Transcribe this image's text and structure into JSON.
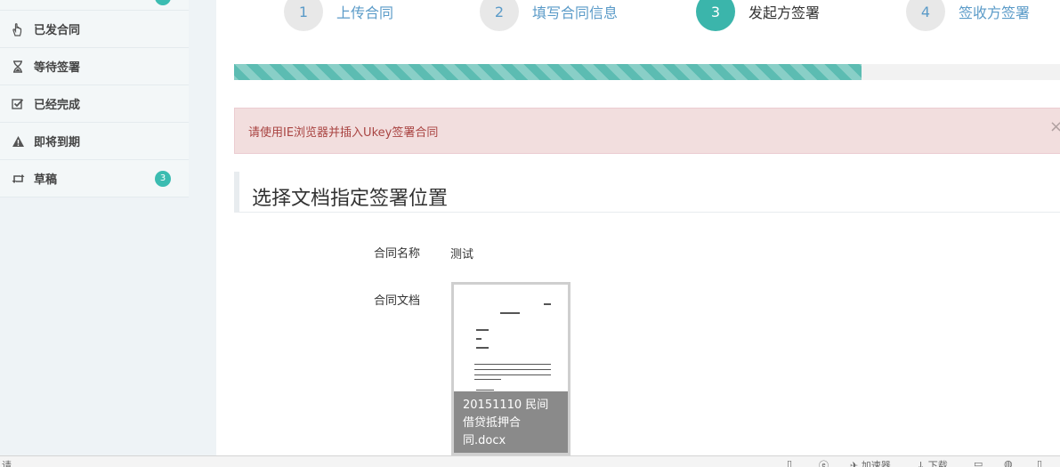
{
  "sidebar": {
    "items": [
      {
        "label": "已发合同",
        "icon": "hand-pointer-icon"
      },
      {
        "label": "等待签署",
        "icon": "hourglass-icon"
      },
      {
        "label": "已经完成",
        "icon": "check-square-icon"
      },
      {
        "label": "即将到期",
        "icon": "warning-icon"
      },
      {
        "label": "草稿",
        "icon": "retweet-icon",
        "badge": "3"
      }
    ]
  },
  "steps": [
    {
      "num": "1",
      "label": "上传合同"
    },
    {
      "num": "2",
      "label": "填写合同信息"
    },
    {
      "num": "3",
      "label": "发起方签署"
    },
    {
      "num": "4",
      "label": "签收方签署"
    }
  ],
  "active_step": 3,
  "progress_percent": 76,
  "alert": {
    "message": "请使用IE浏览器并插入Ukey签署合同",
    "close": "×"
  },
  "section": {
    "title": "选择文档指定签署位置"
  },
  "form": {
    "name_label": "合同名称",
    "name_value": "测试",
    "doc_label": "合同文档",
    "doc_caption": "20151110 民间借贷抵押合同.docx"
  },
  "statusbar": {
    "left": "请",
    "accelerator": "加速器",
    "download": "下载"
  },
  "colors": {
    "accent": "#3bb5ab",
    "link": "#5b9bc8",
    "alert_bg": "#f2dede",
    "alert_text": "#a94442"
  }
}
